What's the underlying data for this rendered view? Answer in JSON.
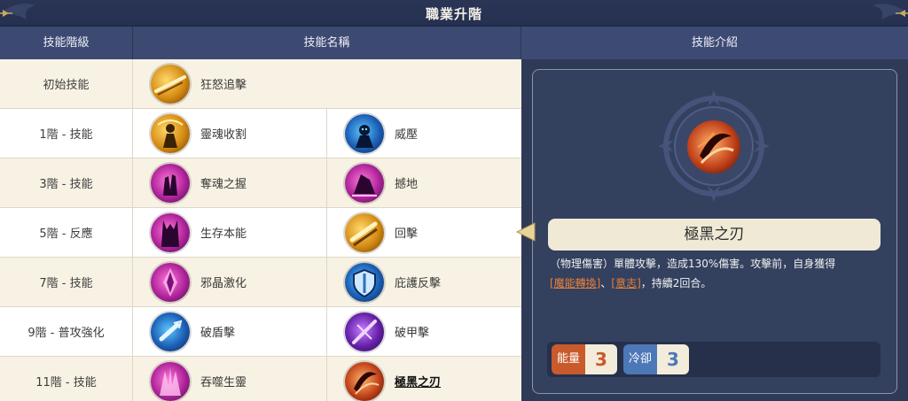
{
  "window": {
    "title": "職業升階"
  },
  "columns": {
    "level": "技能階級",
    "name": "技能名稱",
    "intro": "技能介紹"
  },
  "rows": [
    {
      "level": "初始技能",
      "skills": [
        {
          "name": "狂怒追擊",
          "icon": "sword-slash-icon"
        }
      ]
    },
    {
      "level": "1階 - 技能",
      "skills": [
        {
          "name": "靈魂收割",
          "icon": "reaper-icon"
        },
        {
          "name": "威壓",
          "icon": "intimidate-icon"
        }
      ]
    },
    {
      "level": "3階 - 技能",
      "skills": [
        {
          "name": "奪魂之握",
          "icon": "soul-grasp-icon"
        },
        {
          "name": "撼地",
          "icon": "earthshake-icon"
        }
      ]
    },
    {
      "level": "5階 - 反應",
      "skills": [
        {
          "name": "生存本能",
          "icon": "survival-icon"
        },
        {
          "name": "回擊",
          "icon": "counter-strike-icon"
        }
      ]
    },
    {
      "level": "7階 - 技能",
      "skills": [
        {
          "name": "邪晶激化",
          "icon": "crystal-icon"
        },
        {
          "name": "庇護反擊",
          "icon": "shield-counter-icon"
        }
      ]
    },
    {
      "level": "9階 - 普攻強化",
      "skills": [
        {
          "name": "破盾擊",
          "icon": "shield-break-icon"
        },
        {
          "name": "破甲擊",
          "icon": "armor-break-icon"
        }
      ]
    },
    {
      "level": "11階 - 技能",
      "skills": [
        {
          "name": "吞噬生靈",
          "icon": "devour-icon"
        },
        {
          "name": "極黑之刃",
          "icon": "dark-blade-icon"
        }
      ]
    }
  ],
  "detail": {
    "name": "極黑之刃",
    "desc_before": "（物理傷害）單體攻擊，造成130%傷害。攻擊前，自身獲得",
    "link1": "[魔能轉換]",
    "sep": "、",
    "link2": "[意志]",
    "desc_after": "，持續2回合。",
    "energy_label": "能量",
    "energy_value": "3",
    "cooldown_label": "冷卻",
    "cooldown_value": "3"
  }
}
